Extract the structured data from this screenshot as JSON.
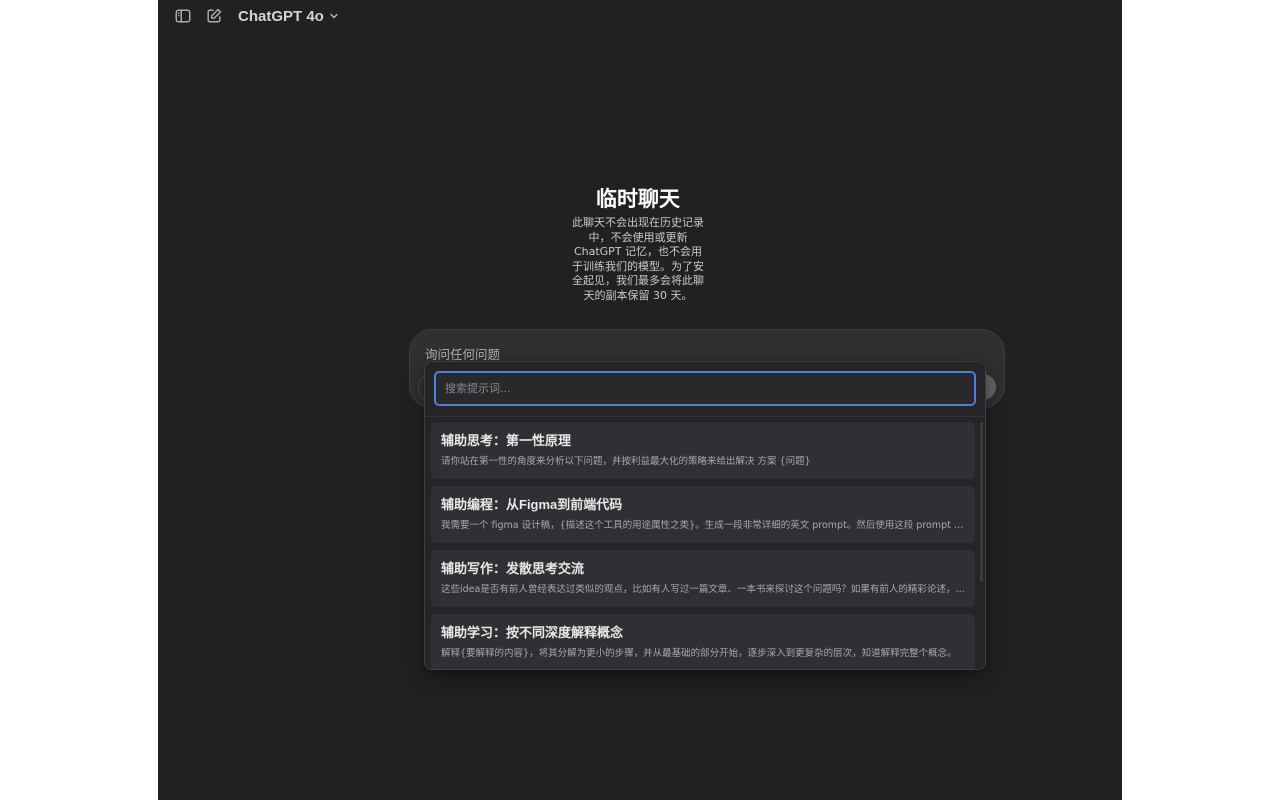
{
  "header": {
    "model_name": "ChatGPT 4o",
    "icons": {
      "sidebar": "sidebar-toggle-icon",
      "new_chat": "new-chat-edit-icon",
      "model_dropdown": "chevron-down-icon"
    }
  },
  "intro": {
    "title": "临时聊天",
    "description": "此聊天不会出现在历史记录中，不会使用或更新 ChatGPT 记忆，也不会用于训练我们的模型。为了安全起见，我们最多会将此聊天的副本保留 30 天。"
  },
  "composer": {
    "placeholder": "询问任何问题"
  },
  "prompt_popup": {
    "search_placeholder": "搜索提示词...",
    "search_value": "",
    "items": [
      {
        "title": "辅助思考：第一性原理",
        "description": "请你站在第一性的角度来分析以下问题，并按利益最大化的策略来给出解决 方案 {问题}"
      },
      {
        "title": "辅助编程：从Figma到前端代码",
        "description": "我需要一个 figma 设计稿，{描述这个工具的用途属性之类}。生成一段非常详细的英文 prompt。然后使用这段 prompt 生成..."
      },
      {
        "title": "辅助写作：发散思考交流",
        "description": "这些idea是否有前人曾经表达过类似的观点，比如有人写过一篇文章、一本书来探讨这个问题吗？如果有前人的精彩论述，可..."
      },
      {
        "title": "辅助学习：按不同深度解释概念",
        "description": "解释{要解释的内容}，将其分解为更小的步骤，并从最基础的部分开始，逐步深入到更复杂的层次，知道解释完整个概念。"
      }
    ]
  },
  "colors": {
    "app_background": "#212121",
    "page_background": "#ffffff",
    "composer_background": "#303030",
    "popup_background": "#252527",
    "item_background": "#303034",
    "focus_ring": "#4f7ed6"
  }
}
